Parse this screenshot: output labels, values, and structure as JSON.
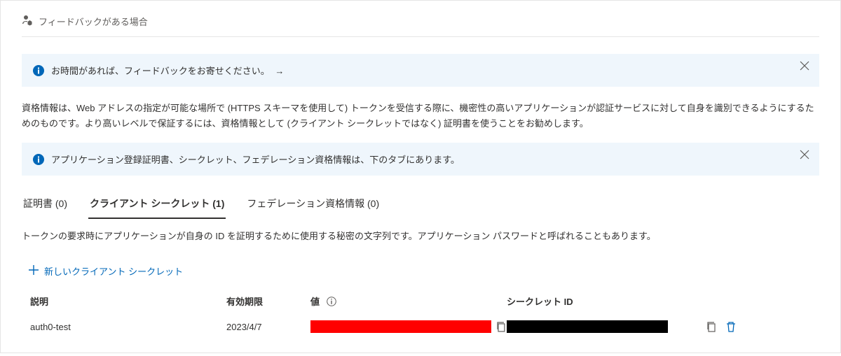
{
  "feedback": {
    "header": "フィードバックがある場合"
  },
  "info_bar_1": {
    "text": "お時間があれば、フィードバックをお寄せください。",
    "arrow": "→"
  },
  "description_paragraph": "資格情報は、Web アドレスの指定が可能な場所で (HTTPS スキーマを使用して) トークンを受信する際に、機密性の高いアプリケーションが認証サービスに対して自身を識別できるようにするためのものです。より高いレベルで保証するには、資格情報として (クライアント シークレットではなく) 証明書を使うことをお勧めします。",
  "info_bar_2": {
    "text": "アプリケーション登録証明書、シークレット、フェデレーション資格情報は、下のタブにあります。"
  },
  "tabs": {
    "certificates": {
      "label": "証明書",
      "count": "(0)"
    },
    "secrets": {
      "label": "クライアント シークレット",
      "count": "(1)"
    },
    "federated": {
      "label": "フェデレーション資格情報",
      "count": "(0)"
    }
  },
  "tab_description": "トークンの要求時にアプリケーションが自身の ID を証明するために使用する秘密の文字列です。アプリケーション パスワードと呼ばれることもあります。",
  "new_secret_label": "新しいクライアント シークレット",
  "table": {
    "headers": {
      "description": "説明",
      "expiry": "有効期限",
      "value": "値",
      "secret_id": "シークレット ID"
    },
    "row": {
      "description": "auth0-test",
      "expiry": "2023/4/7"
    }
  }
}
